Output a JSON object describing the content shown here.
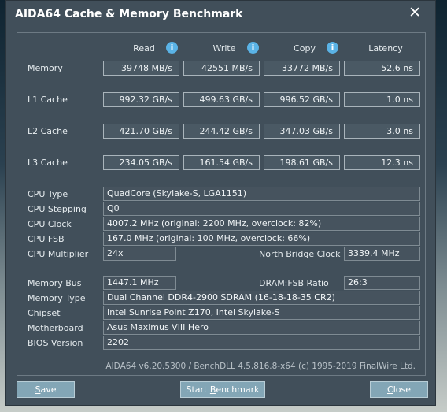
{
  "window": {
    "title": "AIDA64 Cache & Memory Benchmark",
    "close_glyph": "✕"
  },
  "columns": {
    "read": "Read",
    "write": "Write",
    "copy": "Copy",
    "latency": "Latency"
  },
  "info_glyph": "i",
  "bench": {
    "memory": {
      "label": "Memory",
      "read": "39748 MB/s",
      "write": "42551 MB/s",
      "copy": "33772 MB/s",
      "latency": "52.6 ns"
    },
    "l1": {
      "label": "L1 Cache",
      "read": "992.32 GB/s",
      "write": "499.63 GB/s",
      "copy": "996.52 GB/s",
      "latency": "1.0 ns"
    },
    "l2": {
      "label": "L2 Cache",
      "read": "421.70 GB/s",
      "write": "244.42 GB/s",
      "copy": "347.03 GB/s",
      "latency": "3.0 ns"
    },
    "l3": {
      "label": "L3 Cache",
      "read": "234.05 GB/s",
      "write": "161.54 GB/s",
      "copy": "198.61 GB/s",
      "latency": "12.3 ns"
    }
  },
  "cpu": {
    "type_label": "CPU Type",
    "type": "QuadCore   (Skylake-S, LGA1151)",
    "stepping_label": "CPU Stepping",
    "stepping": "Q0",
    "clock_label": "CPU Clock",
    "clock": "4007.2 MHz  (original: 2200 MHz, overclock: 82%)",
    "fsb_label": "CPU FSB",
    "fsb": "167.0 MHz  (original: 100 MHz, overclock: 66%)",
    "multiplier_label": "CPU Multiplier",
    "multiplier": "24x",
    "nb_clock_label": "North Bridge Clock",
    "nb_clock": "3339.4 MHz"
  },
  "system": {
    "membus_label": "Memory Bus",
    "membus": "1447.1 MHz",
    "dram_ratio_label": "DRAM:FSB Ratio",
    "dram_ratio": "26:3",
    "memtype_label": "Memory Type",
    "memtype": "Dual Channel DDR4-2900 SDRAM  (16-18-18-35 CR2)",
    "chipset_label": "Chipset",
    "chipset": "Intel Sunrise Point Z170, Intel Skylake-S",
    "motherboard_label": "Motherboard",
    "motherboard": "Asus Maximus VIII Hero",
    "bios_label": "BIOS Version",
    "bios": "2202"
  },
  "footer": {
    "credit": "AIDA64 v6.20.5300 / BenchDLL 4.5.816.8-x64  (c) 1995-2019 FinalWire Ltd."
  },
  "buttons": {
    "save_first": "S",
    "save_rest": "ave",
    "start_first": "Start ",
    "start_ul": "B",
    "start_rest": "enchmark",
    "close_first": "C",
    "close_rest": "lose"
  }
}
